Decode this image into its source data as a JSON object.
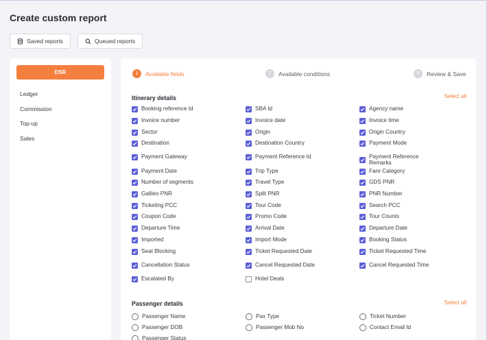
{
  "page": {
    "title": "Create custom report",
    "saved_reports_label": "Saved reports",
    "queued_reports_label": "Queued reports"
  },
  "sidebar": {
    "active_label": "DSR",
    "items": [
      {
        "label": "Ledger"
      },
      {
        "label": "Commission"
      },
      {
        "label": "Top-up"
      },
      {
        "label": "Sales"
      }
    ]
  },
  "steps": [
    {
      "num": "1",
      "label": "Available fields",
      "state": "active"
    },
    {
      "num": "2",
      "label": "Available conditions",
      "state": "inactive"
    },
    {
      "num": "3",
      "label": "Review & Save",
      "state": "inactive"
    }
  ],
  "itinerary": {
    "title": "Itinerary details",
    "select_all": "Select all",
    "fields": [
      {
        "label": "Booking reference Id",
        "checked": true
      },
      {
        "label": "SBA Id",
        "checked": true
      },
      {
        "label": "Agency name",
        "checked": true
      },
      {
        "label": "Invoice number",
        "checked": true
      },
      {
        "label": "Invoice date",
        "checked": true
      },
      {
        "label": "Invoice time",
        "checked": true
      },
      {
        "label": "Sector",
        "checked": true
      },
      {
        "label": "Origin",
        "checked": true
      },
      {
        "label": "Origin Country",
        "checked": true
      },
      {
        "label": "Destination",
        "checked": true
      },
      {
        "label": "Destination Country",
        "checked": true
      },
      {
        "label": "Payment Mode",
        "checked": true
      },
      {
        "label": "Payment Gateway",
        "checked": true
      },
      {
        "label": "Payment Reference Id",
        "checked": true
      },
      {
        "label": "Payment Reference Remarks",
        "checked": true
      },
      {
        "label": "Payment Date",
        "checked": true
      },
      {
        "label": "Trip Type",
        "checked": true
      },
      {
        "label": "Fare Category",
        "checked": true
      },
      {
        "label": "Number of segments",
        "checked": true
      },
      {
        "label": "Travel Type",
        "checked": true
      },
      {
        "label": "GDS PNR",
        "checked": true
      },
      {
        "label": "Galileo PNR",
        "checked": true
      },
      {
        "label": "Split PNR",
        "checked": true
      },
      {
        "label": "PNR Number",
        "checked": true
      },
      {
        "label": "Ticketing PCC",
        "checked": true
      },
      {
        "label": "Tour Code",
        "checked": true
      },
      {
        "label": "Search PCC",
        "checked": true
      },
      {
        "label": "Coupon Code",
        "checked": true
      },
      {
        "label": "Promo Code",
        "checked": true
      },
      {
        "label": "Tour Counts",
        "checked": true
      },
      {
        "label": "Departure Time",
        "checked": true
      },
      {
        "label": "Arrival Date",
        "checked": true
      },
      {
        "label": "Departure Date",
        "checked": true
      },
      {
        "label": "Imported",
        "checked": true
      },
      {
        "label": "Import Mode",
        "checked": true
      },
      {
        "label": "Booking Status",
        "checked": true
      },
      {
        "label": "Seat Blocking",
        "checked": true
      },
      {
        "label": "Ticket Requested Date",
        "checked": true
      },
      {
        "label": "Ticket Requested Time",
        "checked": true
      },
      {
        "label": "Cancellation Status",
        "checked": true
      },
      {
        "label": "Cancel Requested Date",
        "checked": true
      },
      {
        "label": "Cancel Requested Time",
        "checked": true
      },
      {
        "label": "Escalated By",
        "checked": true
      },
      {
        "label": "Hotel Deals",
        "checked": false
      }
    ]
  },
  "passenger": {
    "title": "Passenger details",
    "select_all": "Select all",
    "fields": [
      {
        "label": "Passenger Name"
      },
      {
        "label": "Pax Type"
      },
      {
        "label": "Ticket Number"
      },
      {
        "label": "Passenger DOB"
      },
      {
        "label": "Passenger Mob No"
      },
      {
        "label": "Contact Email Id"
      },
      {
        "label": "Passenger Status"
      }
    ]
  },
  "colors": {
    "accent": "#f47f3e",
    "checkbox": "#5c5fd6"
  }
}
